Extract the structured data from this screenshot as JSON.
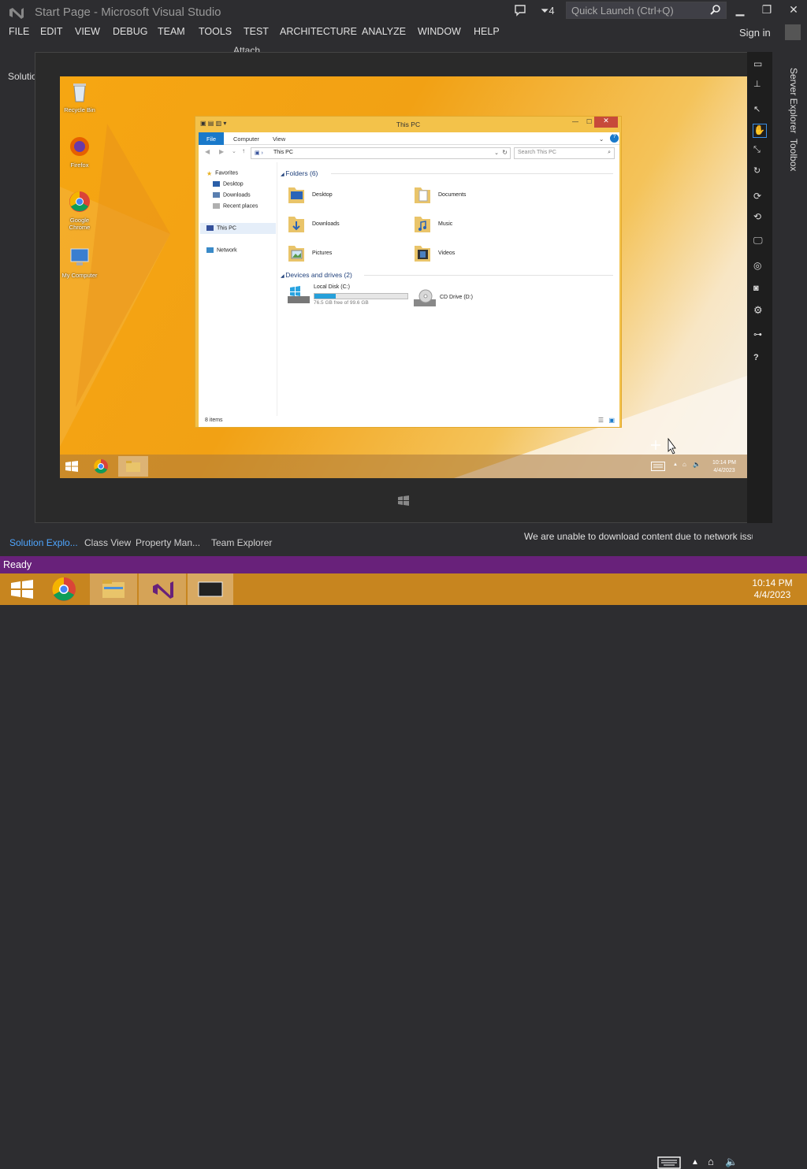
{
  "vs": {
    "title": "Start Page - Microsoft Visual Studio",
    "notifications_count": "4",
    "quick_launch_placeholder": "Quick Launch (Ctrl+Q)",
    "menu": [
      "FILE",
      "EDIT",
      "VIEW",
      "DEBUG",
      "TEAM",
      "TOOLS",
      "TEST",
      "ARCHITECTURE",
      "ANALYZE",
      "WINDOW",
      "HELP"
    ],
    "sign_in": "Sign in",
    "toolbar_attach": "Attach...",
    "solution_header": "Solutio",
    "right_tabs": [
      "Server Explorer",
      "Toolbox"
    ],
    "bottom_tabs": [
      "Solution Explo...",
      "Class View",
      "Property Man...",
      "Team Explorer"
    ],
    "message": "We are unable to download content due to network issu",
    "status": "Ready",
    "accent": "#68217a"
  },
  "host_taskbar": {
    "time": "10:14 PM",
    "date": "4/4/2023",
    "color": "#c7851f"
  },
  "guest": {
    "desktop_icons": [
      "Recycle Bin",
      "Firefox",
      "Google Chrome",
      "My Computer"
    ],
    "time": "10:14 PM",
    "date": "4/4/2023"
  },
  "explorer": {
    "title": "This PC",
    "ribbon_tabs": [
      "File",
      "Computer",
      "View"
    ],
    "address": "This PC",
    "search_placeholder": "Search This PC",
    "nav": {
      "favorites": "Favorites",
      "desktop": "Desktop",
      "downloads": "Downloads",
      "recent": "Recent places",
      "this_pc": "This PC",
      "network": "Network"
    },
    "folders_header": "Folders (6)",
    "folders": [
      "Desktop",
      "Documents",
      "Downloads",
      "Music",
      "Pictures",
      "Videos"
    ],
    "devices_header": "Devices and drives (2)",
    "drive_c": {
      "name": "Local Disk (C:)",
      "free": "76.5 GB free of 99.6 GB",
      "used_fraction": 0.23
    },
    "drive_d": {
      "name": "CD Drive (D:)"
    },
    "item_count": "8 items"
  }
}
